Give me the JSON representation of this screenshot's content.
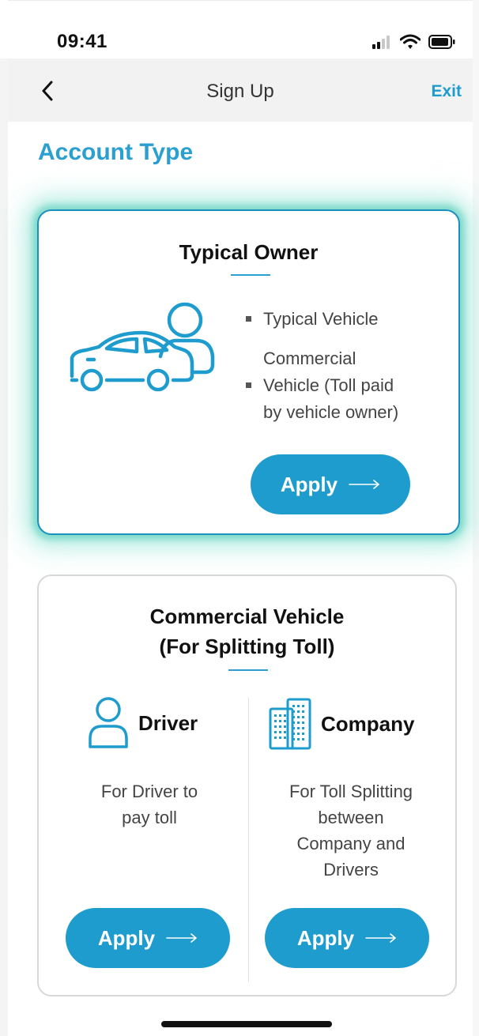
{
  "status_bar": {
    "time": "09:41",
    "icons": [
      "signal-icon",
      "wifi-icon",
      "battery-icon"
    ]
  },
  "nav": {
    "title": "Sign Up",
    "exit_label": "Exit",
    "back_icon": "chevron-left-icon"
  },
  "section_title": "Account Type",
  "owner_card": {
    "title": "Typical Owner",
    "icon": "car-person-icon",
    "bullets": [
      "Typical Vehicle",
      "Commercial Vehicle (Toll paid by vehicle owner)"
    ],
    "bullet_2_lines": [
      "Commercial",
      "Vehicle (Toll paid",
      "by vehicle owner)"
    ],
    "apply_label": "Apply",
    "selected": true
  },
  "commercial_card": {
    "title_line1": "Commercial Vehicle",
    "title_line2": "(For Splitting Toll)",
    "driver": {
      "label": "Driver",
      "icon": "person-icon",
      "desc_lines": [
        "For Driver to",
        "pay toll"
      ],
      "apply_label": "Apply"
    },
    "company": {
      "label": "Company",
      "icon": "building-icon",
      "desc_lines": [
        "For Toll Splitting",
        "between",
        "Company and",
        "Drivers"
      ],
      "apply_label": "Apply"
    }
  },
  "colors": {
    "accent": "#1e9ccd",
    "heading": "#2a9fd0",
    "glow": "#7fd9c8"
  }
}
